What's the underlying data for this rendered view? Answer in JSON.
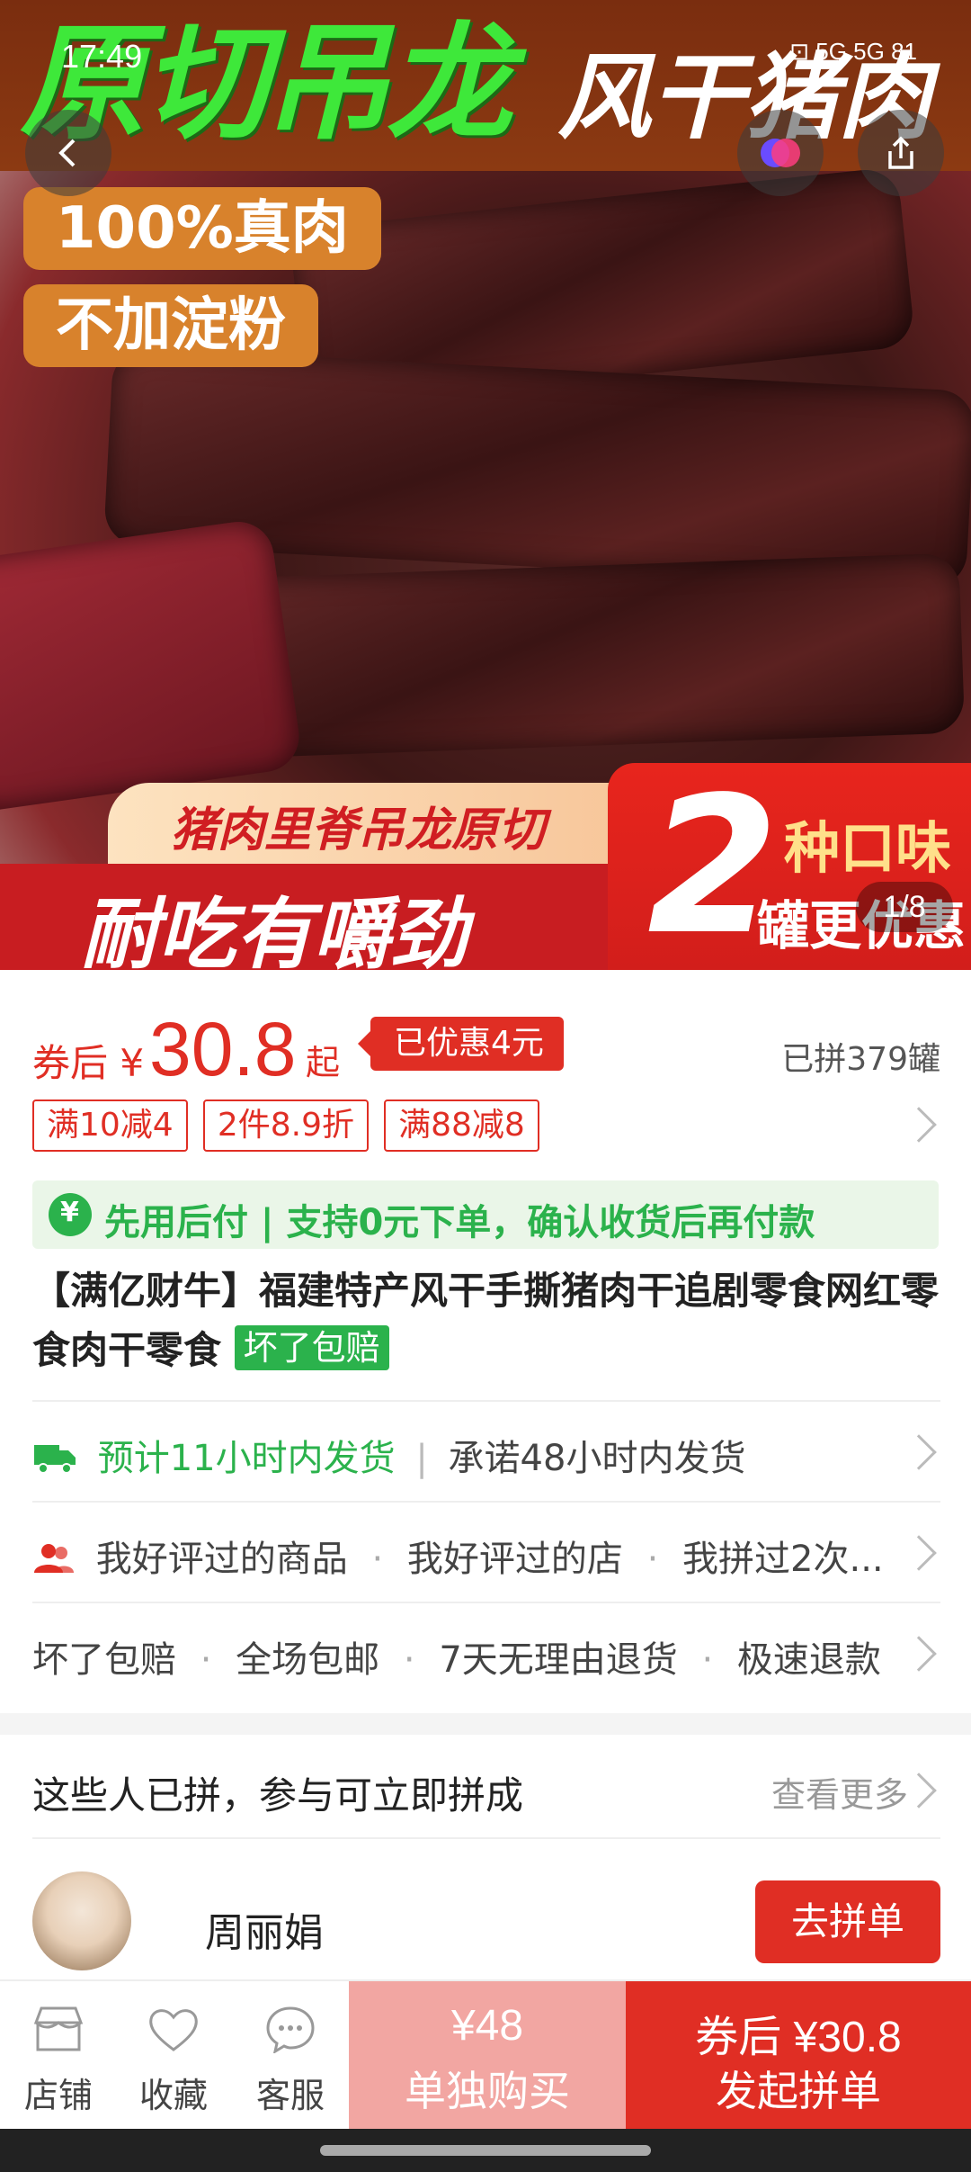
{
  "status_bar": {
    "time": "17:49",
    "indicators": "⊡ 5G 5G 81"
  },
  "hero": {
    "title_green": "原切吊龙",
    "title_white": "风干猪肉",
    "pill_1": "100%真肉",
    "pill_2": "不加淀粉",
    "slogan_top": "猪肉里脊吊龙原切",
    "slogan_main": "耐吃有嚼劲",
    "flavor_number": "2",
    "flavor_line1": "种口味",
    "flavor_line2": "罐更优惠",
    "page_indicator": "1/8"
  },
  "price": {
    "prefix": "券后 ¥",
    "value": "30.8",
    "suffix": "起",
    "discount_badge": "已优惠4元",
    "sold_count": "已拼379罐"
  },
  "coupons": [
    "满10减4",
    "2件8.9折",
    "满88减8"
  ],
  "pay_later": {
    "text": "先用后付 | 支持0元下单，确认收货后再付款"
  },
  "product": {
    "title": "【满亿财牛】福建特产风干手撕猪肉干追剧零食网红零食肉干零食",
    "badge": "坏了包赔"
  },
  "shipping": {
    "estimate": "预计11小时内发货",
    "promise": "承诺48小时内发货"
  },
  "social": {
    "items": [
      "我好评过的商品",
      "我好评过的店",
      "我拼过2次..."
    ]
  },
  "services": {
    "items": [
      "坏了包赔",
      "全场包邮",
      "7天无理由退货",
      "极速退款"
    ]
  },
  "group_section": {
    "label": "这些人已拼，参与可立即拼成",
    "more": "查看更多",
    "member_name": "周丽娟",
    "join_button": "去拼单"
  },
  "bottom_bar": {
    "store": "店铺",
    "favorite": "收藏",
    "service": "客服",
    "single_price": "¥48",
    "single_label": "单独购买",
    "group_price": "券后 ¥30.8",
    "group_label": "发起拼单"
  },
  "colors": {
    "accent_red": "#e02e24",
    "accent_green": "#2bb24c",
    "single_buy_pink": "#f2a6a2"
  }
}
